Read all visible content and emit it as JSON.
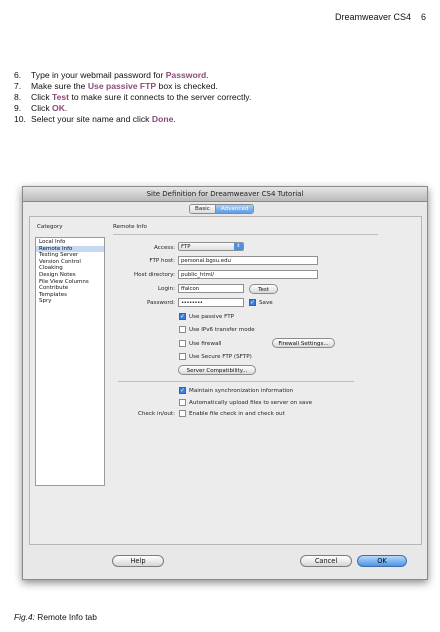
{
  "header": {
    "book_title": "Dreamweaver CS4",
    "page_number": "6"
  },
  "steps": [
    {
      "num": "6.",
      "pre": "Type in your webmail password for ",
      "hl": "Password",
      "post": "."
    },
    {
      "num": "7.",
      "pre": "Make sure the ",
      "hl": "Use passive FTP",
      "post": " box is checked."
    },
    {
      "num": "8.",
      "pre": "Click ",
      "hl": "Test",
      "post": " to make sure it connects to the server correctly."
    },
    {
      "num": "9.",
      "pre": "Click ",
      "hl": "OK",
      "post": "."
    },
    {
      "num": "10.",
      "pre": "Select your site name and click ",
      "hl": "Done",
      "post": "."
    }
  ],
  "dialog": {
    "title": "Site Definition for Dreamweaver CS4 Tutorial",
    "tabs": [
      "Basic",
      "Advanced"
    ],
    "category_label": "Category",
    "categories": [
      "Local Info",
      "Remote Info",
      "Testing Server",
      "Version Control",
      "Cloaking",
      "Design Notes",
      "File View Columns",
      "Contribute",
      "Templates",
      "Spry"
    ],
    "section_title": "Remote Info",
    "access_label": "Access:",
    "access_value": "FTP",
    "ftp_host_label": "FTP host:",
    "ftp_host_value": "personal.bgsu.edu",
    "host_dir_label": "Host directory:",
    "host_dir_value": "public_html/",
    "login_label": "Login:",
    "login_value": "ffalcon",
    "test_button": "Test",
    "password_label": "Password:",
    "password_value": "••••••••",
    "save_label": "Save",
    "passive_ftp": "Use passive FTP",
    "ipv6": "Use IPv6 transfer mode",
    "firewall": "Use firewall",
    "firewall_settings": "Firewall Settings...",
    "sftp": "Use Secure FTP (SFTP)",
    "server_compat": "Server Compatibility...",
    "maintain_sync": "Maintain synchronization information",
    "auto_upload": "Automatically upload files to server on save",
    "checkin_label": "Check in/out:",
    "checkin_option": "Enable file check in and check out",
    "help_button": "Help",
    "cancel_button": "Cancel",
    "ok_button": "OK"
  },
  "caption": {
    "fig": "Fig.4:",
    "text": " Remote Info tab"
  },
  "colors": {
    "highlight": "#8b4a7a",
    "accent": "#4c8fe3"
  }
}
